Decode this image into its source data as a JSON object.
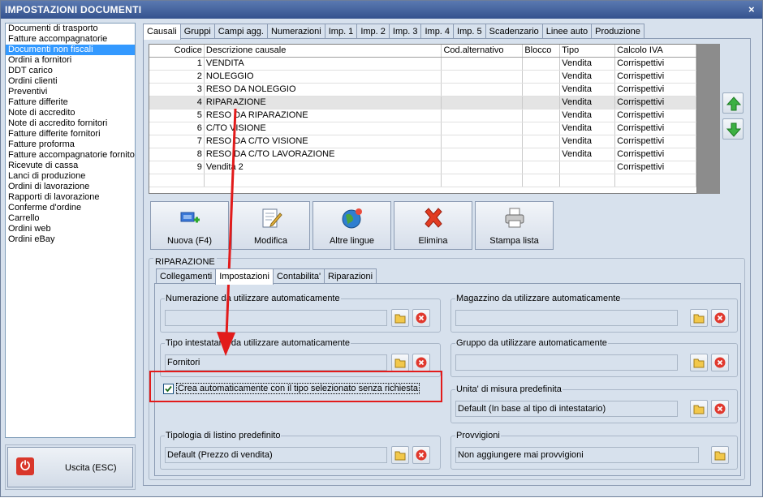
{
  "window": {
    "title": "IMPOSTAZIONI DOCUMENTI",
    "close": "×"
  },
  "left_list": {
    "items": [
      "Documenti di trasporto",
      "Fatture accompagnatorie",
      "Documenti non fiscali",
      "Ordini a fornitori",
      "DDT carico",
      "Ordini clienti",
      "Preventivi",
      "Fatture differite",
      "Note di accredito",
      "Note di accredito fornitori",
      "Fatture differite fornitori",
      "Fatture proforma",
      "Fatture accompagnatorie fornito",
      "Ricevute di cassa",
      "Lanci di produzione",
      "Ordini di lavorazione",
      "Rapporti di lavorazione",
      "Conferme d'ordine",
      "Carrello",
      "Ordini web",
      "Ordini eBay"
    ],
    "selected_index": 2
  },
  "exit_button": {
    "label": "Uscita (ESC)"
  },
  "main_tabs": [
    "Causali",
    "Gruppi",
    "Campi agg.",
    "Numerazioni",
    "Imp. 1",
    "Imp. 2",
    "Imp. 3",
    "Imp. 4",
    "Imp. 5",
    "Scadenzario",
    "Linee auto",
    "Produzione"
  ],
  "active_main_tab": 0,
  "grid": {
    "headers": [
      "Codice",
      "Descrizione causale",
      "Cod.alternativo",
      "Blocco",
      "Tipo",
      "Calcolo IVA"
    ],
    "rows": [
      [
        "1",
        "VENDITA",
        "",
        "",
        "Vendita",
        "Corrispettivi"
      ],
      [
        "2",
        "NOLEGGIO",
        "",
        "",
        "Vendita",
        "Corrispettivi"
      ],
      [
        "3",
        "RESO DA NOLEGGIO",
        "",
        "",
        "Vendita",
        "Corrispettivi"
      ],
      [
        "4",
        "RIPARAZIONE",
        "",
        "",
        "Vendita",
        "Corrispettivi"
      ],
      [
        "5",
        "RESO DA RIPARAZIONE",
        "",
        "",
        "Vendita",
        "Corrispettivi"
      ],
      [
        "6",
        "C/TO VISIONE",
        "",
        "",
        "Vendita",
        "Corrispettivi"
      ],
      [
        "7",
        "RESO DA C/TO VISIONE",
        "",
        "",
        "Vendita",
        "Corrispettivi"
      ],
      [
        "8",
        "RESO DA C/TO LAVORAZIONE",
        "",
        "",
        "Vendita",
        "Corrispettivi"
      ],
      [
        "9",
        "Vendita 2",
        "",
        "",
        "",
        "Corrispettivi"
      ]
    ],
    "selected_row": 3
  },
  "toolbar": {
    "new": "Nuova (F4)",
    "edit": "Modifica",
    "languages": "Altre lingue",
    "delete": "Elimina",
    "print": "Stampa lista"
  },
  "detail": {
    "title": "RIPARAZIONE",
    "tabs": [
      "Collegamenti",
      "Impostazioni",
      "Contabilita'",
      "Riparazioni"
    ],
    "active_tab": 1
  },
  "fields": {
    "numerazione": {
      "label": "Numerazione da utilizzare automaticamente",
      "value": ""
    },
    "magazzino": {
      "label": "Magazzino da utilizzare automaticamente",
      "value": ""
    },
    "tipo_intestatario": {
      "label": "Tipo intestatario da utilizzare automaticamente",
      "value": "Fornitori"
    },
    "gruppo": {
      "label": "Gruppo da utilizzare automaticamente",
      "value": ""
    },
    "unita_misura": {
      "label": "Unita' di misura predefinita",
      "value": "Default (In base al tipo di intestatario)"
    },
    "listino": {
      "label": "Tipologia di listino predefinito",
      "value": "Default (Prezzo di vendita)"
    },
    "provvigioni": {
      "label": "Provvigioni",
      "value": "Non aggiungere mai provvigioni"
    }
  },
  "checkbox": {
    "label": "Crea automaticamente con il tipo selezionato senza richiesta",
    "checked": true
  },
  "colors": {
    "titlebar": "#34528e",
    "selection": "#3399ff",
    "annotation": "#e21b1b",
    "panel": "#d7e1ed"
  }
}
